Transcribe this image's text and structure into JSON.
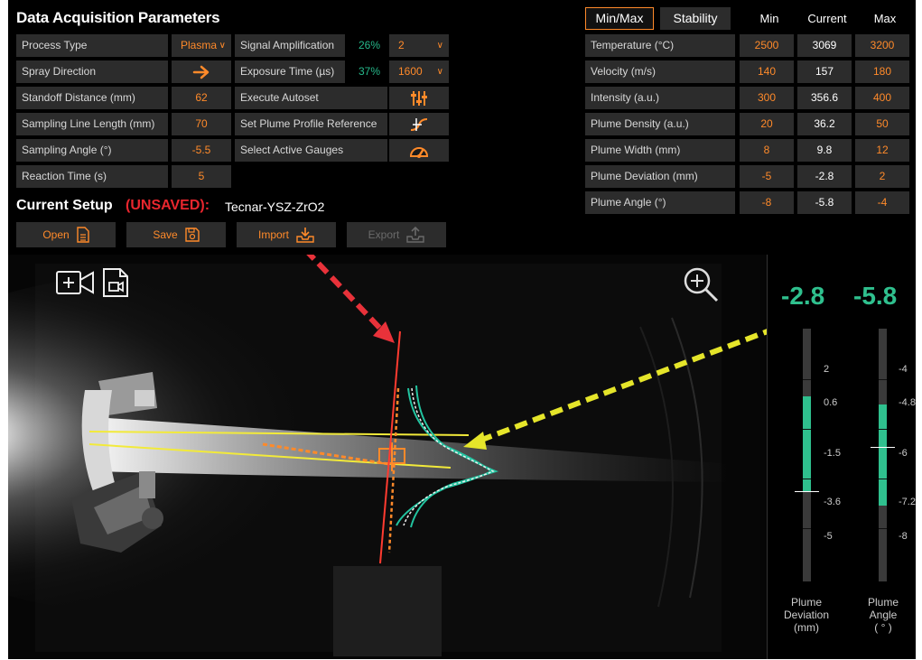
{
  "title": "Data Acquisition Parameters",
  "left_params": [
    {
      "label": "Process Type",
      "value": "Plasma",
      "kind": "dropdown"
    },
    {
      "label": "Spray Direction",
      "icon": "arrow-right-icon",
      "kind": "icon"
    },
    {
      "label": "Standoff Distance (mm)",
      "value": "62",
      "kind": "value"
    },
    {
      "label": "Sampling Line Length (mm)",
      "value": "70",
      "kind": "value"
    },
    {
      "label": "Sampling Angle (°)",
      "value": "-5.5",
      "kind": "value"
    },
    {
      "label": "Reaction Time (s)",
      "value": "5",
      "kind": "value"
    }
  ],
  "mid_params": [
    {
      "label": "Signal Amplification",
      "percent": "26%",
      "value": "2",
      "kind": "dropdown"
    },
    {
      "label": "Exposure Time (µs)",
      "percent": "37%",
      "value": "1600",
      "kind": "dropdown"
    },
    {
      "label": "Execute Autoset",
      "icon": "autoset-sliders-icon",
      "kind": "icon"
    },
    {
      "label": "Set Plume Profile Reference",
      "icon": "plume-reference-icon",
      "kind": "icon"
    },
    {
      "label": "Select Active Gauges",
      "icon": "gauge-icon",
      "kind": "icon"
    }
  ],
  "setup": {
    "label": "Current Setup",
    "unsaved": "(UNSAVED):",
    "name": "Tecnar-YSZ-ZrO2"
  },
  "file_buttons": [
    {
      "label": "Open",
      "icon": "open-file-icon",
      "enabled": true
    },
    {
      "label": "Save",
      "icon": "save-disk-icon",
      "enabled": true
    },
    {
      "label": "Import",
      "icon": "import-tray-icon",
      "enabled": true
    },
    {
      "label": "Export",
      "icon": "export-tray-icon",
      "enabled": false
    }
  ],
  "tabs": [
    {
      "label": "Min/Max",
      "active": true
    },
    {
      "label": "Stability",
      "active": false
    }
  ],
  "columns": {
    "min": "Min",
    "current": "Current",
    "max": "Max"
  },
  "measurements": [
    {
      "label": "Temperature (°C)",
      "min": "2500",
      "current": "3069",
      "max": "3200"
    },
    {
      "label": "Velocity (m/s)",
      "min": "140",
      "current": "157",
      "max": "180"
    },
    {
      "label": "Intensity (a.u.)",
      "min": "300",
      "current": "356.6",
      "max": "400"
    },
    {
      "label": "Plume Density (a.u.)",
      "min": "20",
      "current": "36.2",
      "max": "50"
    },
    {
      "label": "Plume Width (mm)",
      "min": "8",
      "current": "9.8",
      "max": "12"
    },
    {
      "label": "Plume Deviation (mm)",
      "min": "-5",
      "current": "-2.8",
      "max": "2"
    },
    {
      "label": "Plume Angle (°)",
      "min": "-8",
      "current": "-5.8",
      "max": "-4"
    }
  ],
  "viewer": {
    "icons": [
      "add-camera-icon",
      "video-file-icon",
      "zoom-in-icon"
    ],
    "overlay_colors": {
      "sampling": "#ff3b30",
      "plume_axis": "#f2ea3a",
      "profile": "#22c4a0",
      "reference": "#ff8a2a"
    }
  },
  "gauges": [
    {
      "value": "-2.8",
      "caption": [
        "Plume",
        "Deviation",
        "(mm)"
      ],
      "scale_min": -6,
      "scale_max": 3,
      "current": -2.8,
      "range_low": -2.8,
      "range_high": 0.6,
      "ticks": [
        "2",
        "0.6",
        "-1.5",
        "-3.6",
        "-5"
      ]
    },
    {
      "value": "-5.8",
      "caption": [
        "Plume",
        "Angle",
        "( ° )"
      ],
      "scale_min": -9,
      "scale_max": -3,
      "current": -5.8,
      "range_low": -7.2,
      "range_high": -4.8,
      "ticks": [
        "-4",
        "-4.8",
        "-6",
        "-7.2",
        "-8"
      ]
    }
  ],
  "colors": {
    "accent": "#ff8a2a",
    "good": "#2fc08e",
    "warning": "#e8262e",
    "panel": "#2c2c2c"
  }
}
